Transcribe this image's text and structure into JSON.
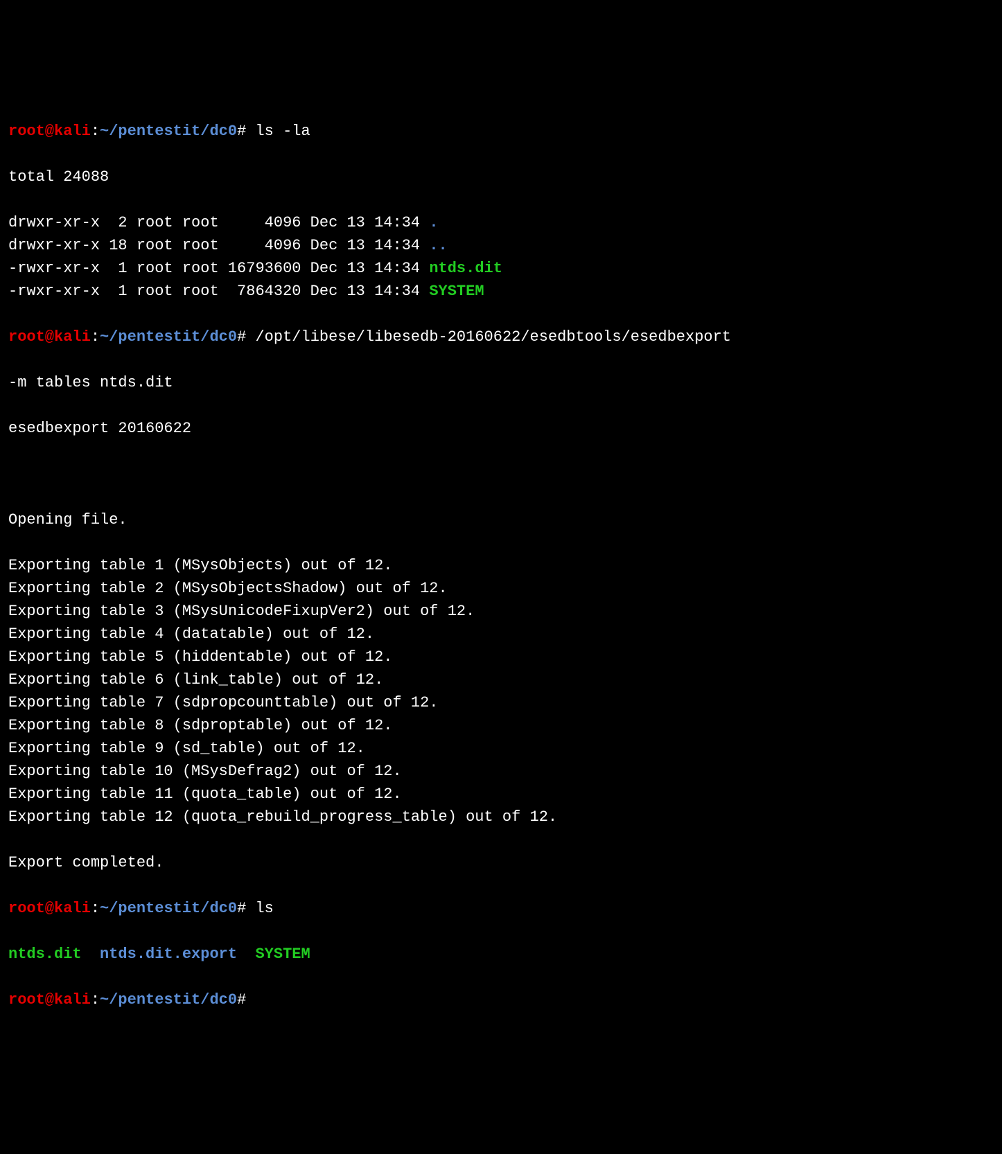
{
  "prompt": {
    "user": "root@kali",
    "colon": ":",
    "path": "~/pentestit/dc0",
    "hash": "#"
  },
  "cmd1": "ls -la",
  "total_line": "total 24088",
  "ls_entries": [
    {
      "perms": "drwxr-xr-x",
      "links": " 2",
      "owner": "root",
      "group": "root",
      "size": "    4096",
      "date": "Dec 13 14:34",
      "name": ".",
      "color": "blue"
    },
    {
      "perms": "drwxr-xr-x",
      "links": "18",
      "owner": "root",
      "group": "root",
      "size": "    4096",
      "date": "Dec 13 14:34",
      "name": "..",
      "color": "blue"
    },
    {
      "perms": "-rwxr-xr-x",
      "links": " 1",
      "owner": "root",
      "group": "root",
      "size": "16793600",
      "date": "Dec 13 14:34",
      "name": "ntds.dit",
      "color": "green"
    },
    {
      "perms": "-rwxr-xr-x",
      "links": " 1",
      "owner": "root",
      "group": "root",
      "size": " 7864320",
      "date": "Dec 13 14:34",
      "name": "SYSTEM",
      "color": "green"
    }
  ],
  "cmd2_part1": "/opt/libese/libesedb-20160622/esedbtools/esedbexport ",
  "cmd2_part2": "-m tables ntds.dit",
  "tool_version": "esedbexport 20160622",
  "opening_line": "Opening file.",
  "exports": [
    "Exporting table 1 (MSysObjects) out of 12.",
    "Exporting table 2 (MSysObjectsShadow) out of 12.",
    "Exporting table 3 (MSysUnicodeFixupVer2) out of 12.",
    "Exporting table 4 (datatable) out of 12.",
    "Exporting table 5 (hiddentable) out of 12.",
    "Exporting table 6 (link_table) out of 12.",
    "Exporting table 7 (sdpropcounttable) out of 12.",
    "Exporting table 8 (sdproptable) out of 12.",
    "Exporting table 9 (sd_table) out of 12.",
    "Exporting table 10 (MSysDefrag2) out of 12.",
    "Exporting table 11 (quota_table) out of 12.",
    "Exporting table 12 (quota_rebuild_progress_table) out of 12."
  ],
  "export_done": "Export completed.",
  "cmd3": "ls",
  "ls2": {
    "item1": "ntds.dit",
    "item2": "ntds.dit.export",
    "item3": "SYSTEM"
  }
}
